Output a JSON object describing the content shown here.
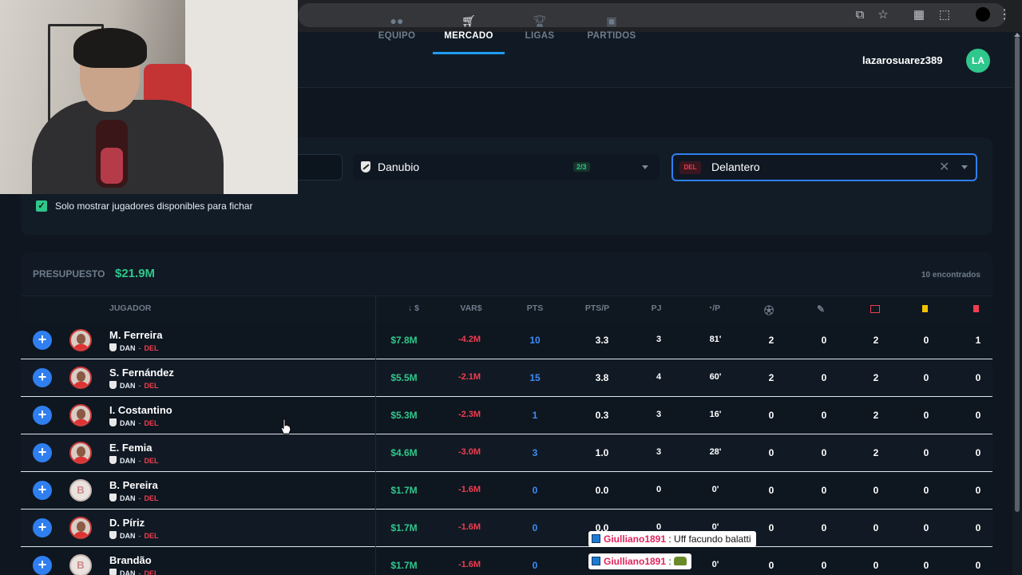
{
  "nav": {
    "tabs": [
      {
        "label": "EQUIPO",
        "icon": "users-icon"
      },
      {
        "label": "MERCADO",
        "icon": "cart-icon"
      },
      {
        "label": "LIGAS",
        "icon": "trophy-icon"
      },
      {
        "label": "PARTIDOS",
        "icon": "calendar-icon"
      }
    ],
    "active_tab": "MERCADO",
    "username": "lazarosuarez389",
    "avatar_initials": "LA"
  },
  "filters": {
    "club": {
      "value": "Danubio",
      "badge": "2/3"
    },
    "position": {
      "badge": "DEL",
      "value": "Delantero"
    },
    "available_only": {
      "label": "Solo mostrar jugadores disponibles para fichar",
      "checked": true
    }
  },
  "market": {
    "budget_label": "PRESUPUESTO",
    "budget_value": "$21.9M",
    "found_label": "10 encontrados",
    "columns": {
      "player": "JUGADOR",
      "price": "↓ $",
      "var": "VAR$",
      "pts": "PTS",
      "ptsp": "PTS/P",
      "pj": "PJ",
      "minutes": "/P"
    },
    "rows": [
      {
        "name": "M. Ferreira",
        "club": "DAN",
        "pos": "DEL",
        "price": "$7.8M",
        "var": "-4.2M",
        "pts": "10",
        "ptsp": "3.3",
        "pj": "3",
        "min": "81'",
        "g": "2",
        "a": "0",
        "s": "2",
        "y": "0",
        "r": "1",
        "photo": true
      },
      {
        "name": "S. Fernández",
        "club": "DAN",
        "pos": "DEL",
        "price": "$5.5M",
        "var": "-2.1M",
        "pts": "15",
        "ptsp": "3.8",
        "pj": "4",
        "min": "60'",
        "g": "2",
        "a": "0",
        "s": "2",
        "y": "0",
        "r": "0",
        "photo": true
      },
      {
        "name": "I. Costantino",
        "club": "DAN",
        "pos": "DEL",
        "price": "$5.3M",
        "var": "-2.3M",
        "pts": "1",
        "ptsp": "0.3",
        "pj": "3",
        "min": "16'",
        "g": "0",
        "a": "0",
        "s": "2",
        "y": "0",
        "r": "0",
        "photo": true
      },
      {
        "name": "E. Femia",
        "club": "DAN",
        "pos": "DEL",
        "price": "$4.6M",
        "var": "-3.0M",
        "pts": "3",
        "ptsp": "1.0",
        "pj": "3",
        "min": "28'",
        "g": "0",
        "a": "0",
        "s": "2",
        "y": "0",
        "r": "0",
        "photo": true
      },
      {
        "name": "B. Pereira",
        "club": "DAN",
        "pos": "DEL",
        "price": "$1.7M",
        "var": "-1.6M",
        "pts": "0",
        "ptsp": "0.0",
        "pj": "0",
        "min": "0'",
        "g": "0",
        "a": "0",
        "s": "0",
        "y": "0",
        "r": "0",
        "photo": false,
        "initial": "B"
      },
      {
        "name": "D. Píriz",
        "club": "DAN",
        "pos": "DEL",
        "price": "$1.7M",
        "var": "-1.6M",
        "pts": "0",
        "ptsp": "0.0",
        "pj": "0",
        "min": "0'",
        "g": "0",
        "a": "0",
        "s": "0",
        "y": "0",
        "r": "0",
        "photo": true
      },
      {
        "name": "Brandão",
        "club": "DAN",
        "pos": "DEL",
        "price": "$1.7M",
        "var": "-1.6M",
        "pts": "0",
        "ptsp": "0.0",
        "pj": "0",
        "min": "0'",
        "g": "0",
        "a": "0",
        "s": "0",
        "y": "0",
        "r": "0",
        "photo": false,
        "initial": "B"
      }
    ]
  },
  "chat": [
    {
      "user": "Giulliano1891",
      "message": ": Uff facundo balatti"
    },
    {
      "user": "Giulliano1891",
      "message": ":"
    }
  ],
  "colors": {
    "accent": "#2f7ff0",
    "green": "#2fc78b",
    "red": "#ef3d4f",
    "bg": "#0f1620"
  }
}
